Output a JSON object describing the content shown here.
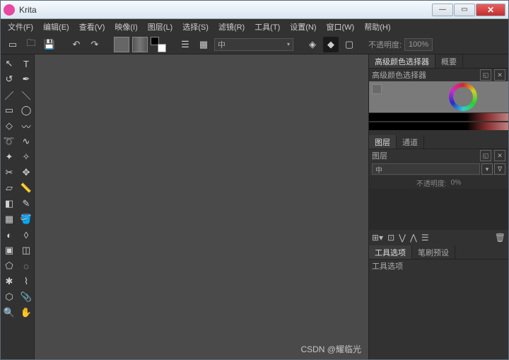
{
  "title": "Krita",
  "menu": [
    "文件(F)",
    "编辑(E)",
    "查看(V)",
    "映像(I)",
    "图层(L)",
    "选择(S)",
    "滤镜(R)",
    "工具(T)",
    "设置(N)",
    "窗口(W)",
    "帮助(H)"
  ],
  "toolbar": {
    "brush_mode": "中",
    "opacity_label": "不透明度:",
    "opacity_value": "100%"
  },
  "right": {
    "top_tabs": [
      "高级颜色选择器",
      "概要"
    ],
    "color_selector_title": "高级颜色选择器",
    "layer_tabs": [
      "图层",
      "通道"
    ],
    "layer_title": "图层",
    "blend_mode": "中",
    "layer_opacity_label": "不透明度:",
    "layer_opacity_value": "0%",
    "bottom_tabs": [
      "工具选项",
      "笔刷预设"
    ],
    "tool_options_title": "工具选项"
  },
  "tools": [
    "arrow-cursor",
    "text",
    "freehand-select",
    "transform",
    "line",
    "eraser",
    "rect",
    "ellipse",
    "polygon",
    "polyline",
    "bezier",
    "freehand-path",
    "calligraphy",
    "pencil",
    "crop",
    "move",
    "perspective",
    "ruler",
    "gradient",
    "color-picker",
    "pattern",
    "fill",
    "smart-fill",
    "assistants",
    "select-rect",
    "select-similar",
    "select-poly",
    "select-outline",
    "select-contig",
    "select-bezier",
    "select-magnetic",
    "reference",
    "zoom",
    "pan"
  ],
  "watermark": "CSDN @耀临光"
}
